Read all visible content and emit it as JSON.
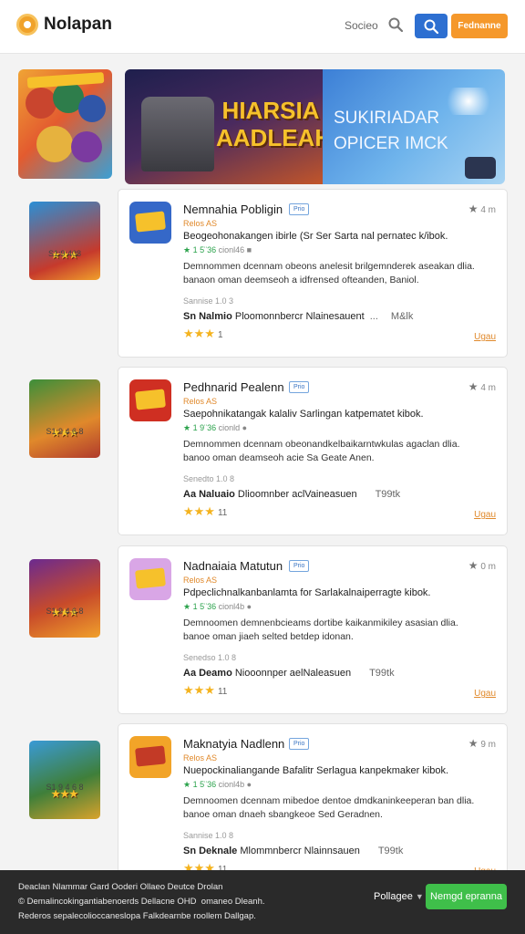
{
  "header": {
    "brand": "Nolapan",
    "search_label": "Socieo",
    "cta_label": "Fednanne"
  },
  "hero": {
    "banner_title": "HIARSIA AADLEAH",
    "banner_right_title": "SUKIRIADAR OPICER IMCK"
  },
  "apps": [
    {
      "side_rating": "S1:9 408",
      "card": {
        "title": "Nemnahia Pobligin",
        "badge": "Prio",
        "fav_count": "4 m",
        "category": "Relos AS",
        "line1": "Beogeohonakangen ibirle (Sr Ser Sarta nal pernatec k/ibok.",
        "line2_green": "★ 1 5¨36",
        "line2_rest": "cionl46 ■",
        "line3": "Demnommen dcennam obeons anelesit brilgemnderek aseakan dlia.",
        "line4": "banaon oman deemseoh a idfrensed ofteanden, Baniol.",
        "meta": "Sannise 1.0 3",
        "review_name": "Sn Nalmio",
        "review_text": "Ploomonnbercr Nlainesauent",
        "review_ext": "...",
        "review_ext2": "M&lk",
        "stars_n": "1",
        "more": "Ugau"
      }
    },
    {
      "side_rating": "S1 9 4 6 8",
      "card": {
        "title": "Pedhnarid Pealenn",
        "badge": "Prio",
        "fav_count": "4 m",
        "category": "Relos AS",
        "line1": "Saepohnikatangak kalaliv Sarlingan katpematet kibok.",
        "line2_green": "★ 1 9¨36",
        "line2_rest": "cionld ●",
        "line3": "Demnommen dcennam obeonandkelbaikarntwkulas agaclan dlia.",
        "line4": "banoo oman deamseoh acie Sa Geate Anen.",
        "meta": "Senedto 1.0 8",
        "review_name": "Aa Naluaio",
        "review_text": "Dlioomnber aclVaineasuen",
        "review_ext": "",
        "review_ext2": "T99tk",
        "stars_n": "11",
        "more": "Ugau"
      }
    },
    {
      "side_rating": "S1 9 4 6 8",
      "card": {
        "title": "Nadnaiaia Matutun",
        "badge": "Prio",
        "fav_count": "0 m",
        "category": "Relos AS",
        "line1": "Pdpeclichnalkanbanlamta for Sarlakalnaiperragte kibok.",
        "line2_green": "★ 1 5¨36",
        "line2_rest": "cionl4b ●",
        "line3": "Demnoomen demnenbcieams dortibe kaikanmikiley asasian dlia.",
        "line4": "banoe oman jiaeh selted betdep idonan.",
        "meta": "Senedso 1.0 8",
        "review_name": "Aa Deamo",
        "review_text": "Niooonnper aelNaleasuen",
        "review_ext": "",
        "review_ext2": "T99tk",
        "stars_n": "11",
        "more": "Ugau"
      }
    },
    {
      "side_rating": "S1 9 4 6 8",
      "card": {
        "title": "Maknatyia Nadlenn",
        "badge": "Prio",
        "fav_count": "9 m",
        "category": "Relos AS",
        "line1": "Nuepockinaliangande Bafalitr Serlagua kanpekmaker kibok.",
        "line2_green": "★ 1 5¨36",
        "line2_rest": "cionl4b ●",
        "line3": "Demnoomen dcennam mibedoe dentoe dmdkaninkeeperan ban dlia.",
        "line4": "banoe oman dnaeh sbangkeoe Sed Geradnen.",
        "meta": "Sannise 1.0 8",
        "review_name": "Sn Deknale",
        "review_text": "Mlommnbercr Nlainnsauen",
        "review_ext": "",
        "review_ext2": "T99tk",
        "stars_n": "11",
        "more": "Ugau"
      }
    }
  ],
  "cookie": {
    "line1": "Deaclan Nlammar Gard Ooderi Ollaeo  Deutce Drolan",
    "line2": "© Demalincokingantiabenoerds Dellacne OHD  omaneo Dleanh.",
    "line3": "Rederos sepalecolioccaneslopa Falkdearnbe roollem Dallgap.",
    "language": "Pollagee",
    "accept": "Nemgd epranna"
  },
  "colors": {
    "brand_orange": "#f5982b",
    "search_blue": "#2d6fd1",
    "accept_green": "#3fbf4a",
    "star_gold": "#f4b31f",
    "category_orange": "#e0892b",
    "link_blue": "#3c76c3"
  },
  "icons": [
    "logo-icon",
    "search-icon",
    "star-icon",
    "chevron-down-icon",
    "app-icon"
  ]
}
